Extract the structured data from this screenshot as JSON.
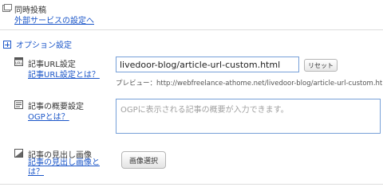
{
  "sync": {
    "title": "同時投稿",
    "external_link": "外部サービスの設定へ"
  },
  "options": {
    "label": "オプション設定"
  },
  "article_url": {
    "label": "記事URL設定",
    "help_link": "記事URL設定とは？",
    "value": "livedoor-blog/article-url-custom.html",
    "reset_label": "リセット",
    "preview": "プレビュー：http://webfreelance-athome.net/livedoor-blog/article-url-custom.html"
  },
  "summary": {
    "label": "記事の概要設定",
    "help_link": "OGPとは？",
    "placeholder": "OGPに表示される記事の概要が入力できます。"
  },
  "heading_image": {
    "label": "記事の見出し画像",
    "help_link": "記事の見出し画像とは？",
    "button_label": "画像選択"
  },
  "colors": {
    "link": "#1a55c8",
    "input_border": "#77a0d8"
  }
}
